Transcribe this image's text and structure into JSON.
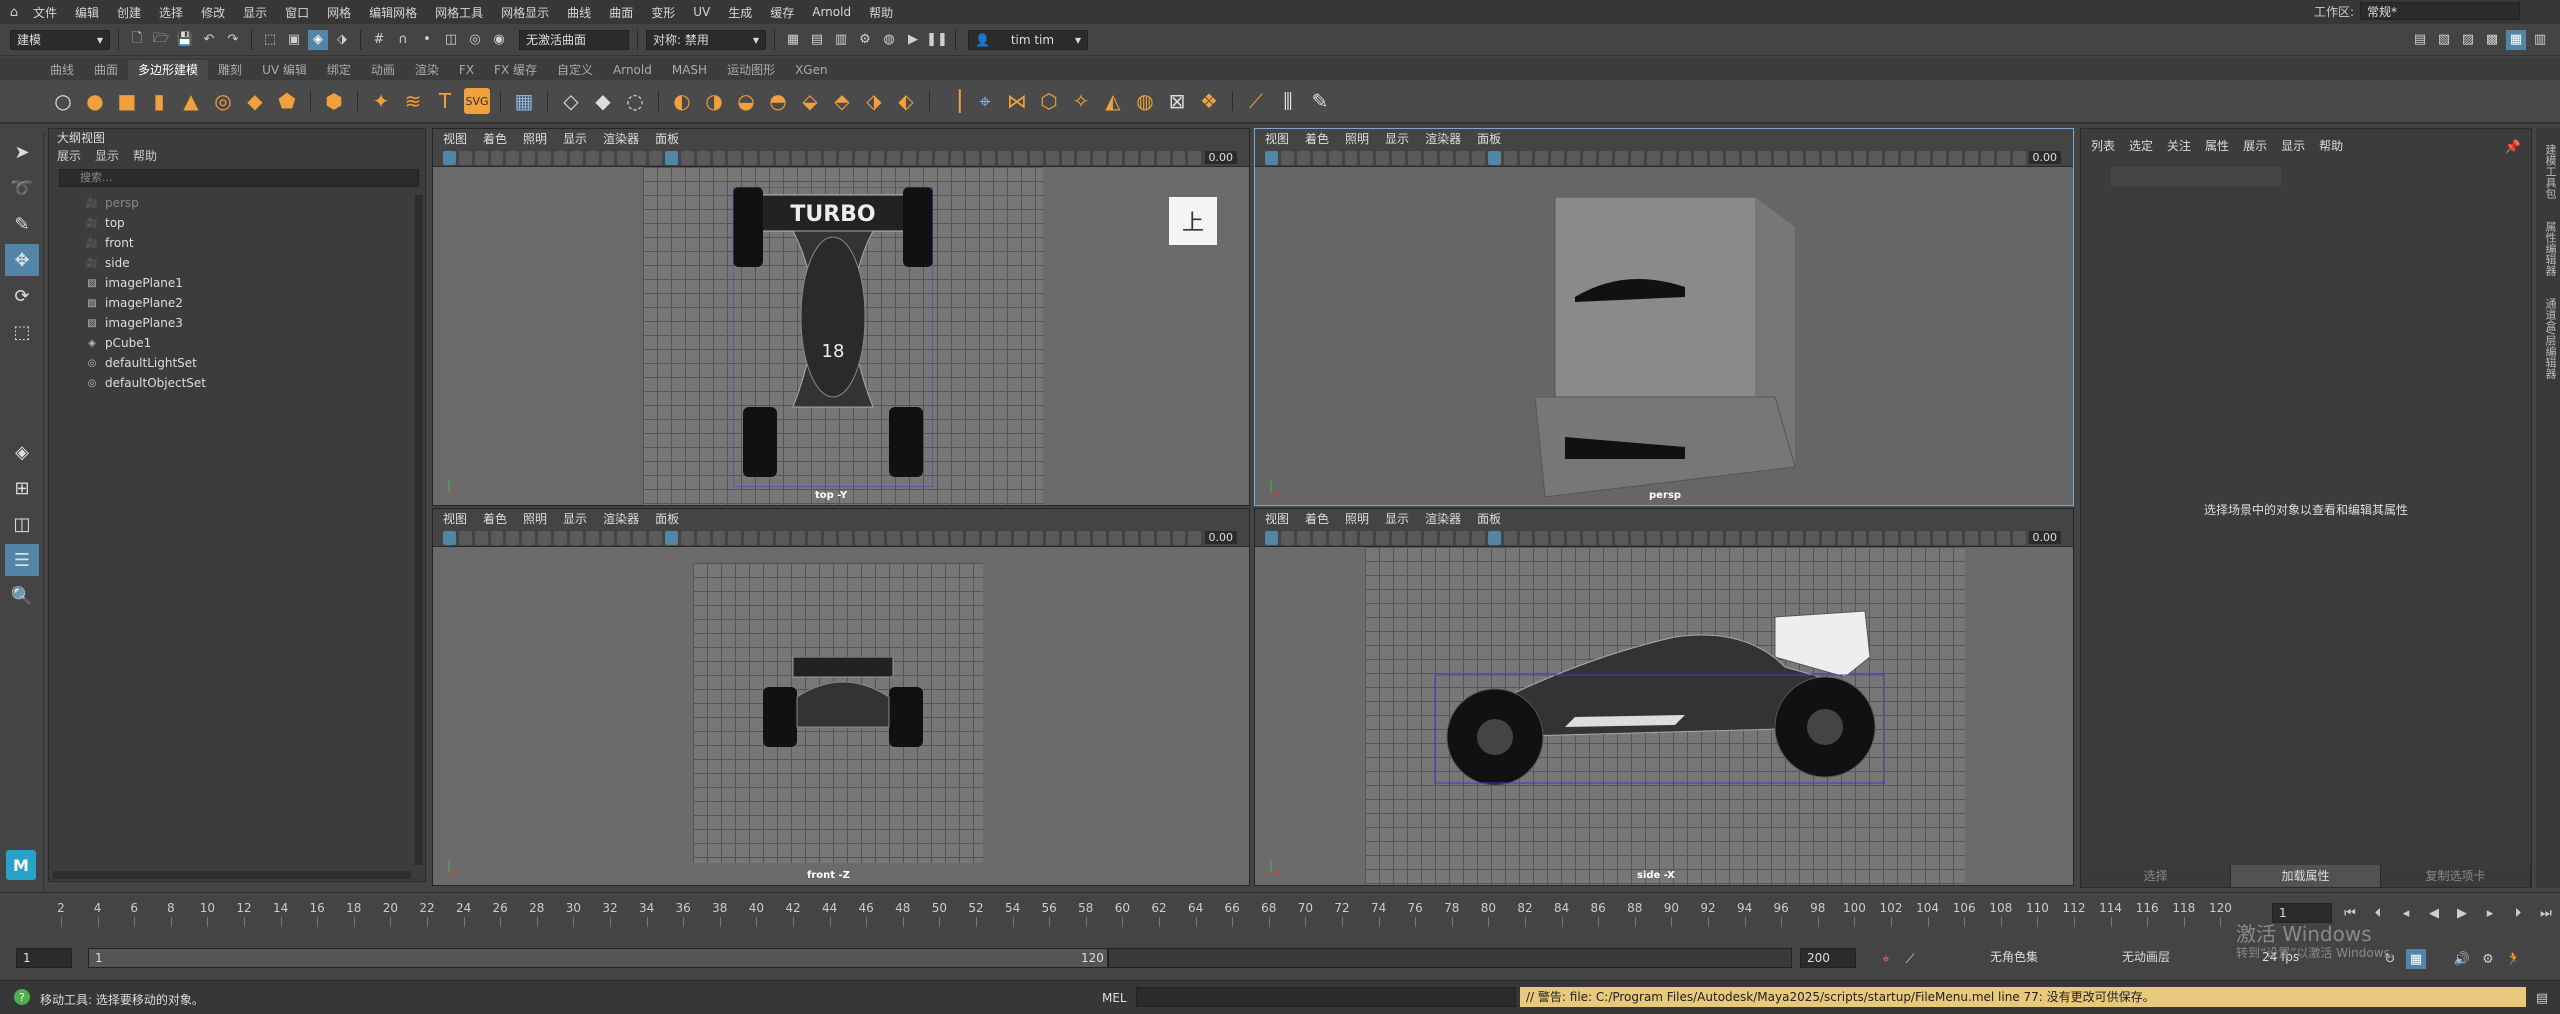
{
  "menubar": {
    "items": [
      "文件",
      "编辑",
      "创建",
      "选择",
      "修改",
      "显示",
      "窗口",
      "网格",
      "编辑网格",
      "网格工具",
      "网格显示",
      "曲线",
      "曲面",
      "变形",
      "UV",
      "生成",
      "缓存",
      "Arnold",
      "帮助"
    ],
    "workspace_label": "工作区:",
    "workspace_value": "常规*"
  },
  "statusline": {
    "mode": "建模",
    "no_live_surface": "无激活曲面",
    "symmetry": "对称: 禁用",
    "user": "tim tim"
  },
  "shelf": {
    "tabs": [
      "曲线",
      "曲面",
      "多边形建模",
      "雕刻",
      "UV 编辑",
      "绑定",
      "动画",
      "渲染",
      "FX",
      "FX 缓存",
      "自定义",
      "Arnold",
      "MASH",
      "运动图形",
      "XGen"
    ],
    "active_tab": "多边形建模"
  },
  "outliner": {
    "title": "大纲视图",
    "menu": [
      "展示",
      "显示",
      "帮助"
    ],
    "search_placeholder": "搜索...",
    "items": [
      {
        "label": "persp",
        "icon": "camera-icon",
        "dim": true
      },
      {
        "label": "top",
        "icon": "camera-icon",
        "dim": false
      },
      {
        "label": "front",
        "icon": "camera-icon",
        "dim": false
      },
      {
        "label": "side",
        "icon": "camera-icon",
        "dim": false
      },
      {
        "label": "imagePlane1",
        "icon": "image-plane-icon",
        "dim": false
      },
      {
        "label": "imagePlane2",
        "icon": "image-plane-icon",
        "dim": false
      },
      {
        "label": "imagePlane3",
        "icon": "image-plane-icon",
        "dim": false
      },
      {
        "label": "pCube1",
        "icon": "mesh-icon",
        "dim": false
      },
      {
        "label": "defaultLightSet",
        "icon": "set-icon",
        "dim": false
      },
      {
        "label": "defaultObjectSet",
        "icon": "set-icon",
        "dim": false
      }
    ]
  },
  "viewport": {
    "menu": [
      "视图",
      "着色",
      "照明",
      "显示",
      "渲染器",
      "面板"
    ],
    "value": "0.00",
    "top_label": "top -Y",
    "persp_label": "persp",
    "front_label": "front -Z",
    "side_label": "side -X",
    "viewcube_label": "上",
    "car_text": "TURBO",
    "car_number": "18"
  },
  "attribute_editor": {
    "menu": [
      "列表",
      "选定",
      "关注",
      "属性",
      "展示",
      "显示",
      "帮助"
    ],
    "message": "选择场景中的对象以查看和编辑其属性",
    "buttons": [
      "选择",
      "加载属性",
      "复制选项卡"
    ]
  },
  "side_tabs": [
    "建模工具包",
    "属性编辑器",
    "通道盒/层编辑器"
  ],
  "timeline": {
    "ticks": [
      "2",
      "4",
      "6",
      "8",
      "10",
      "12",
      "14",
      "16",
      "18",
      "20",
      "22",
      "24",
      "26",
      "28",
      "30",
      "32",
      "34",
      "36",
      "38",
      "40",
      "42",
      "44",
      "46",
      "48",
      "50",
      "52",
      "54",
      "56",
      "58",
      "60",
      "62",
      "64",
      "66",
      "68",
      "70",
      "72",
      "74",
      "76",
      "78",
      "80",
      "82",
      "84",
      "86",
      "88",
      "90",
      "92",
      "94",
      "96",
      "98",
      "100",
      "102",
      "104",
      "106",
      "108",
      "110",
      "112",
      "114",
      "116",
      "118",
      "120"
    ],
    "current_frame": "1"
  },
  "range": {
    "start": "1",
    "inner_start": "1",
    "inner_end": "120",
    "end": "200",
    "char_set": "无角色集",
    "anim_layer": "无动画层",
    "fps": "24 fps"
  },
  "command": {
    "status": "移动工具: 选择要移动的对象。",
    "mel": "MEL",
    "warning": "// 警告: file: C:/Program Files/Autodesk/Maya2025/scripts/startup/FileMenu.mel line 77: 没有更改可供保存。"
  },
  "watermark": {
    "line1": "激活 Windows",
    "line2": "转到“设置”以激活 Windows。"
  }
}
